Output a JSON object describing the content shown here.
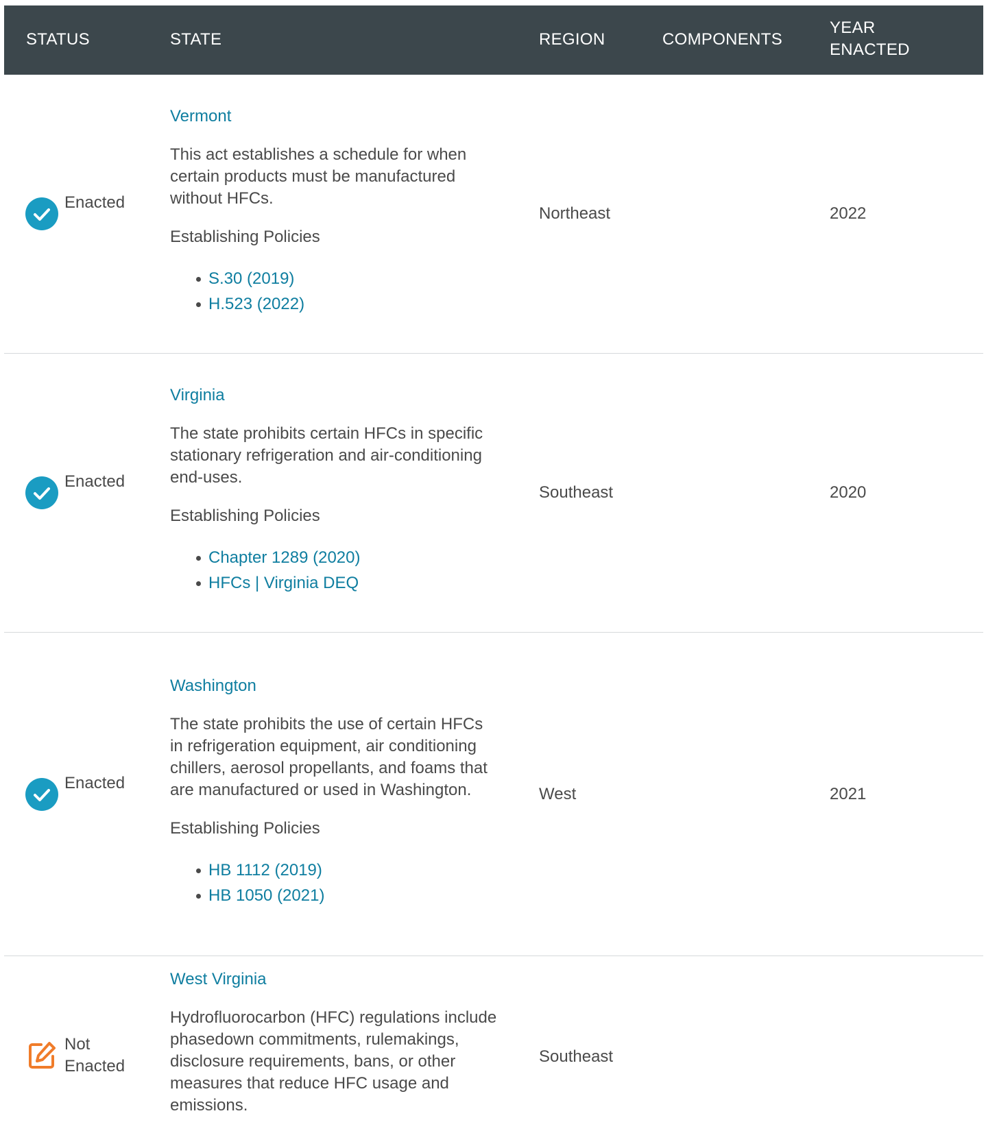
{
  "header": {
    "status": "STATUS",
    "state": "STATE",
    "region": "REGION",
    "components": "COMPONENTS",
    "year": "YEAR ENACTED"
  },
  "colors": {
    "header_bg": "#3c474c",
    "link": "#0f7ea0",
    "enacted_icon": "#1a9cc2",
    "not_enacted_icon": "#f07c2a"
  },
  "rows": [
    {
      "status": "Enacted",
      "status_icon": "check-circle-icon",
      "state": "Vermont",
      "description": "This act establishes a schedule for when certain products must be manufactured without HFCs.",
      "establishing_label": "Establishing Policies",
      "policies": [
        "S.30 (2019)",
        "H.523 (2022)"
      ],
      "region": "Northeast",
      "components": "",
      "year": "2022"
    },
    {
      "status": "Enacted",
      "status_icon": "check-circle-icon",
      "state": "Virginia",
      "description": "The state prohibits certain HFCs in specific stationary refrigeration and air-conditioning end-uses.",
      "establishing_label": "Establishing Policies",
      "policies": [
        "Chapter 1289 (2020)",
        "HFCs | Virginia DEQ"
      ],
      "region": "Southeast",
      "components": "",
      "year": "2020"
    },
    {
      "status": "Enacted",
      "status_icon": "check-circle-icon",
      "state": "Washington",
      "description": "The state prohibits the use of certain HFCs in refrigeration equipment, air conditioning chillers, aerosol propellants, and foams that are manufactured or used in Washington.",
      "establishing_label": "Establishing Policies",
      "policies": [
        "HB 1112 (2019)",
        "HB 1050 (2021)"
      ],
      "region": "West",
      "components": "",
      "year": "2021"
    },
    {
      "status": "Not Enacted",
      "status_icon": "edit-icon",
      "state": "West Virginia",
      "description": "Hydrofluorocarbon (HFC) regulations include phasedown commitments, rulemakings, disclosure requirements, bans, or other measures that reduce HFC usage and emissions.",
      "region": "Southeast",
      "components": "",
      "year": ""
    }
  ]
}
